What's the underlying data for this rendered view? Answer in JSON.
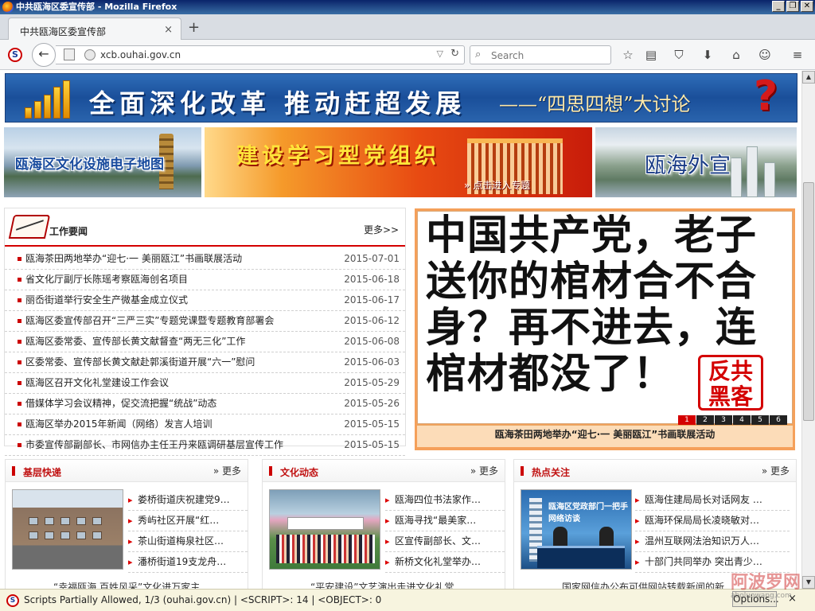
{
  "window": {
    "title": "中共瓯海区委宣传部 - Mozilla Firefox",
    "buttons": {
      "minimize": "_",
      "restore": "❐",
      "close": "✕"
    }
  },
  "tab": {
    "label": "中共瓯海区委宣传部",
    "close": "×",
    "new_tab": "+"
  },
  "navbar": {
    "url": "xcb.ouhai.gov.cn",
    "search_placeholder": "Search",
    "noscript_icon": "S"
  },
  "banner": {
    "title": "全面深化改革  推动赶超发展",
    "subtitle": "——“四思四想”大讨论",
    "question_mark": "?"
  },
  "promos": {
    "map_label": "瓯海区文化设施电子地图",
    "party_label": "建设学习型党组织",
    "party_enter": "» 点击进入专题",
    "outer_label": "瓯海外宣"
  },
  "news": {
    "title": "工作要闻",
    "more": "更多>>",
    "items": [
      {
        "title": "瓯海茶田两地举办“迎七·一  美丽瓯江”书画联展活动",
        "date": "2015-07-01"
      },
      {
        "title": "省文化厅副厅长陈瑶考察瓯海创名项目",
        "date": "2015-06-18"
      },
      {
        "title": "丽岙街道举行安全生产微基金成立仪式",
        "date": "2015-06-17"
      },
      {
        "title": "瓯海区委宣传部召开“三严三实”专题党课暨专题教育部署会",
        "date": "2015-06-12"
      },
      {
        "title": "瓯海区委常委、宣传部长黄文献督查“两无三化”工作",
        "date": "2015-06-08"
      },
      {
        "title": "区委常委、宣传部长黄文献赴郭溪街道开展“六一”慰问",
        "date": "2015-06-03"
      },
      {
        "title": "瓯海区召开文化礼堂建设工作会议",
        "date": "2015-05-29"
      },
      {
        "title": "借媒体学习会议精神，促交流把握“统战”动态",
        "date": "2015-05-26"
      },
      {
        "title": "瓯海区举办2015年新闻（网络）发言人培训",
        "date": "2015-05-15"
      },
      {
        "title": "市委宣传部副部长、市网信办主任王丹来瓯调研基层宣传工作",
        "date": "2015-05-15"
      }
    ]
  },
  "slideshow": {
    "text": "中国共产党，老子送你的棺材合不合身？再不进去，连棺材都没了！",
    "stamp_line1": "反共",
    "stamp_line2": "黑客",
    "pages": [
      "1",
      "2",
      "3",
      "4",
      "5",
      "6"
    ],
    "active_page": "1",
    "caption": "瓯海茶田两地举办“迎七·一  美丽瓯江”书画联展活动"
  },
  "panels": [
    {
      "title": "基层快递",
      "more": "» 更多",
      "items": [
        "娄桥街道庆祝建党9…",
        "秀屿社区开展“红…",
        "茶山街道梅泉社区…",
        "潘桥街道19支龙舟…"
      ],
      "next": "“幸福瓯海 百姓风采”文化进万家主…"
    },
    {
      "title": "文化动态",
      "more": "» 更多",
      "items": [
        "瓯海四位书法家作…",
        "瓯海寻找“最美家…",
        "区宣传副部长、文…",
        "新桥文化礼堂举办…"
      ],
      "next": "“平安建设”文艺演出走进文化礼堂…"
    },
    {
      "title": "热点关注",
      "more": "» 更多",
      "items": [
        "瓯海住建局局长对话网友 …",
        "瓯海环保局局长凌晓敏对…",
        "温州互联网法治知识万人…",
        "十部门共同举办 突出青少…"
      ],
      "next": "国家网信办公布可供网站转载新闻的新…",
      "image_caption": "瓯海区党政部门一把手网络访谈"
    }
  ],
  "statusbar": {
    "text": "Scripts Partially Allowed, 1/3 (ouhai.gov.cn) | <SCRIPT>: 14 | <OBJECT>: 0",
    "options_button": "Options...",
    "close": "×"
  },
  "watermark": {
    "main": "阿波罗网",
    "sub": "aboluowang.com"
  }
}
